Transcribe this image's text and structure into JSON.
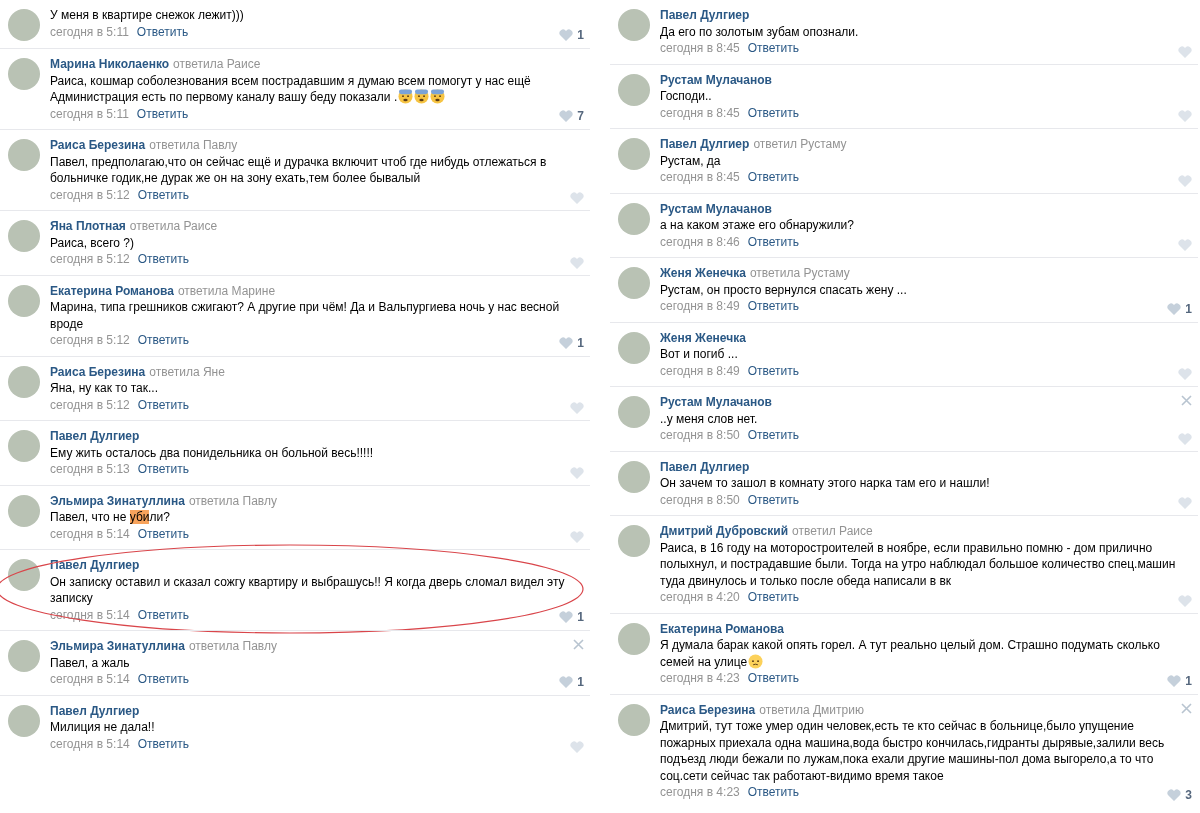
{
  "columns": [
    {
      "comments": [
        {
          "text": "У меня в квартире снежок лежит)))",
          "time": "сегодня в 5:11",
          "reply": "Ответить",
          "likes": "1",
          "deletable": false,
          "circled": false
        },
        {
          "author": "Марина Николаенко",
          "reply_to": "ответила Раисе",
          "text": "Раиса, кошмар соболезнования всем пострадавшим я думаю всем помогут у нас ещё Администрация есть по первому каналу вашу беду показали .",
          "emoji": [
            {
              "kind": "worried"
            },
            {
              "kind": "worried"
            },
            {
              "kind": "worried"
            }
          ],
          "time": "сегодня в 5:11",
          "reply": "Ответить",
          "likes": "7",
          "deletable": false,
          "circled": false
        },
        {
          "author": "Раиса Березина",
          "reply_to": "ответила Павлу",
          "text": "Павел, предполагаю,что он сейчас ещё и дурачка включит чтоб где нибудь отлежаться в больничке годик,не дурак же он на зону ехать,тем более бывалый",
          "time": "сегодня в 5:12",
          "reply": "Ответить",
          "deletable": false,
          "circled": false
        },
        {
          "author": "Яна Плотная",
          "reply_to": "ответила Раисе",
          "text": "Раиса, всего ?)",
          "time": "сегодня в 5:12",
          "reply": "Ответить",
          "deletable": false,
          "circled": false
        },
        {
          "author": "Екатерина Романова",
          "reply_to": "ответила Марине",
          "text": "Марина, типа грешников сжигают? А другие при чём! Да и Вальпургиева ночь у нас весной вроде",
          "time": "сегодня в 5:12",
          "reply": "Ответить",
          "likes": "1",
          "deletable": false,
          "circled": false
        },
        {
          "author": "Раиса Березина",
          "reply_to": "ответила Яне",
          "text": "Яна, ну как то так...",
          "time": "сегодня в 5:12",
          "reply": "Ответить",
          "deletable": false,
          "circled": false
        },
        {
          "author": "Павел Дулгиер",
          "text": "Ему жить осталось два понидельника он больной весь!!!!!",
          "time": "сегодня в 5:13",
          "reply": "Ответить",
          "deletable": false,
          "circled": false
        },
        {
          "author": "Эльмира Зинатуллина",
          "reply_to": "ответила Павлу",
          "text_parts": [
            {
              "text": "Павел, что не ",
              "highlighted": false
            },
            {
              "text": "уби",
              "highlighted": true
            },
            {
              "text": "ли?",
              "highlighted": false
            }
          ],
          "time": "сегодня в 5:14",
          "reply": "Ответить",
          "deletable": false,
          "circled": false
        },
        {
          "author": "Павел Дулгиер",
          "text": "Он записку оставил и сказал сожгу квартиру и выбрашусь!! Я когда дверь сломал видел эту записку",
          "time": "сегодня в 5:14",
          "reply": "Ответить",
          "likes": "1",
          "deletable": false,
          "circled": true
        },
        {
          "author": "Эльмира Зинатуллина",
          "reply_to": "ответила Павлу",
          "text": "Павел, а жаль",
          "time": "сегодня в 5:14",
          "reply": "Ответить",
          "likes": "1",
          "deletable": true,
          "circled": false
        },
        {
          "author": "Павел Дулгиер",
          "text": "Милиция не дала!!",
          "time": "сегодня в 5:14",
          "reply": "Ответить",
          "deletable": false,
          "circled": false
        }
      ]
    },
    {
      "comments": [
        {
          "author": "Павел Дулгиер",
          "text": "Да его по золотым зубам опознали.",
          "time": "сегодня в 8:45",
          "reply": "Ответить",
          "deletable": false,
          "circled": false
        },
        {
          "author": "Рустам Мулачанов",
          "text": "Господи..",
          "time": "сегодня в 8:45",
          "reply": "Ответить",
          "deletable": false,
          "circled": false
        },
        {
          "author": "Павел Дулгиер",
          "reply_to": "ответил Рустаму",
          "text": "Рустам, да",
          "time": "сегодня в 8:45",
          "reply": "Ответить",
          "deletable": false,
          "circled": false
        },
        {
          "author": "Рустам Мулачанов",
          "text": "а на каком этаже его обнаружили?",
          "time": "сегодня в 8:46",
          "reply": "Ответить",
          "deletable": false,
          "circled": false
        },
        {
          "author": "Женя Женечка",
          "reply_to": "ответила Рустаму",
          "text": "Рустам, он просто вернулся спасать жену ...",
          "time": "сегодня в 8:49",
          "reply": "Ответить",
          "likes": "1",
          "deletable": false,
          "circled": false
        },
        {
          "author": "Женя Женечка",
          "text": "Вот и погиб ...",
          "time": "сегодня в 8:49",
          "reply": "Ответить",
          "deletable": false,
          "circled": false
        },
        {
          "author": "Рустам Мулачанов",
          "text": "..у меня слов нет.",
          "time": "сегодня в 8:50",
          "reply": "Ответить",
          "deletable": true,
          "circled": false
        },
        {
          "author": "Павел Дулгиер",
          "text": "Он зачем то зашол в комнату этого нарка там его и нашли!",
          "time": "сегодня в 8:50",
          "reply": "Ответить",
          "deletable": false,
          "circled": false
        },
        {
          "author": "Дмитрий Дубровский",
          "reply_to": "ответил Раисе",
          "text": "Раиса, в 16 году на моторостроителей в ноябре, если правильно помню - дом прилично полыхнул, и пострадавшие были. Тогда на утро наблюдал большое количество спец.машин туда двинулось и только после обеда написали в вк",
          "time": "сегодня в 4:20",
          "reply": "Ответить",
          "deletable": false,
          "circled": false
        },
        {
          "author": "Екатерина Романова",
          "text": "Я думала барак какой опять горел. А тут реально целый дом. Страшно подумать сколько семей на улице",
          "emoji": [
            {
              "kind": "pensive"
            }
          ],
          "time": "сегодня в 4:23",
          "reply": "Ответить",
          "likes": "1",
          "deletable": false,
          "circled": false
        },
        {
          "author": "Раиса Березина",
          "reply_to": "ответила Дмитрию",
          "text": "Дмитрий, тут тоже умер один человек,есть те кто сейчас в больнице,было упущение пожарных приехала одна машина,вода быстро кончилась,гидранты дырявые,залили весь подъезд люди бежали по лужам,пока ехали другие машины-пол дома выгорело,а то что соц.сети сейчас так работают-видимо время такое",
          "time": "сегодня в 4:23",
          "reply": "Ответить",
          "likes": "3",
          "deletable": true,
          "circled": false
        }
      ]
    }
  ]
}
